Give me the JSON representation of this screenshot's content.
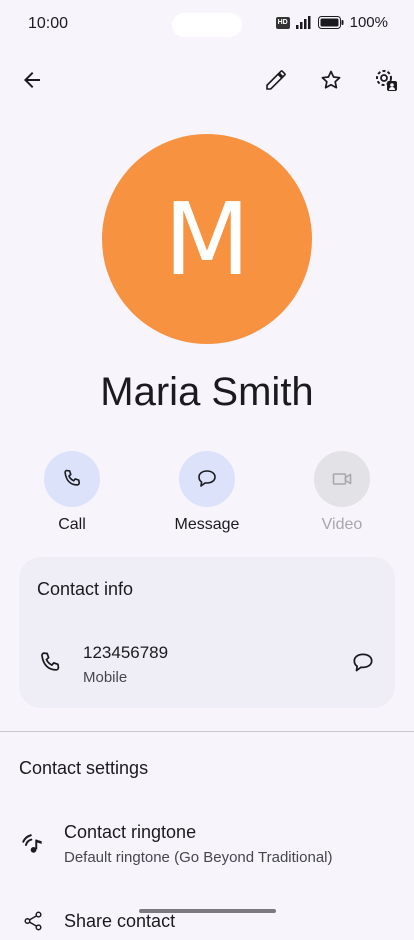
{
  "status_bar": {
    "time": "10:00",
    "hd_badge": "HD",
    "battery": "100%"
  },
  "toolbar": {
    "back_icon": "arrow-left-icon",
    "edit_icon": "pencil-icon",
    "star_icon": "star-outline-icon",
    "settings_icon": "contact-settings-gear-icon"
  },
  "contact": {
    "initial": "M",
    "name": "Maria Smith",
    "avatar_color": "#f79240"
  },
  "actions": {
    "call_label": "Call",
    "message_label": "Message",
    "video_label": "Video"
  },
  "contact_info": {
    "title": "Contact info",
    "number": "123456789",
    "type": "Mobile"
  },
  "contact_settings": {
    "heading": "Contact settings",
    "ringtone_title": "Contact ringtone",
    "ringtone_value": "Default ringtone (Go Beyond Traditional)",
    "share_title": "Share contact"
  },
  "colors": {
    "background": "#f7f4fb",
    "action_bg": "#dce2f9",
    "card_bg": "#efedf5"
  }
}
